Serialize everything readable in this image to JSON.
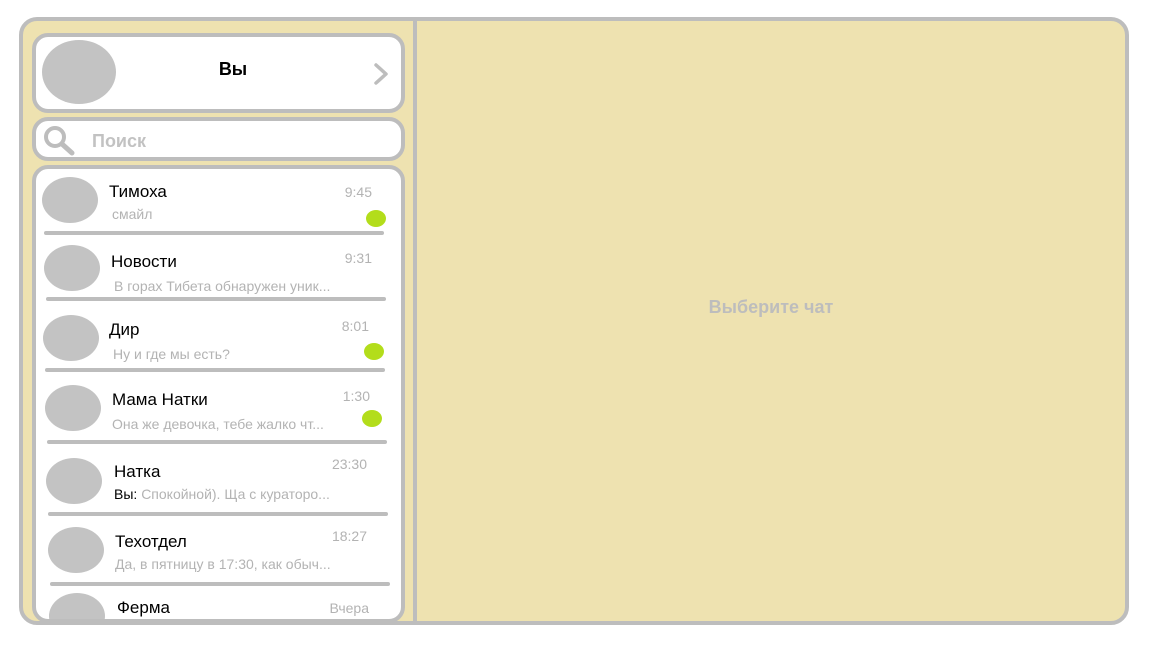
{
  "profile": {
    "name": "Вы"
  },
  "search": {
    "placeholder": "Поиск"
  },
  "chats": [
    {
      "name": "Тимоха",
      "time": "9:45",
      "preview": "смайл",
      "you_prefix": "",
      "unread": true
    },
    {
      "name": "Новости",
      "time": "9:31",
      "preview": "В горах Тибета обнаружен уник...",
      "you_prefix": "",
      "unread": false
    },
    {
      "name": "Дир",
      "time": "8:01",
      "preview": "Ну и где мы есть?",
      "you_prefix": "",
      "unread": true
    },
    {
      "name": "Мама Натки",
      "time": "1:30",
      "preview": "Она же девочка, тебе жалко чт...",
      "you_prefix": "",
      "unread": true
    },
    {
      "name": "Натка",
      "time": "23:30",
      "preview": "Спокойной). Ща с кураторо...",
      "you_prefix": "Вы:",
      "unread": false
    },
    {
      "name": "Техотдел",
      "time": "18:27",
      "preview": "Да, в пятницу в 17:30, как обыч...",
      "you_prefix": "",
      "unread": false
    },
    {
      "name": "Ферма",
      "time": "Вчера",
      "preview": "",
      "you_prefix": "",
      "unread": false
    }
  ],
  "main": {
    "empty_text": "Выберите чат"
  },
  "colors": {
    "background": "#eee2b0",
    "border": "#bdbdbd",
    "unread_dot": "#b3dd1b",
    "muted_text": "#b3b3b3"
  },
  "icons": {
    "search": "search-icon",
    "profile_open": "chevron-right-icon"
  }
}
